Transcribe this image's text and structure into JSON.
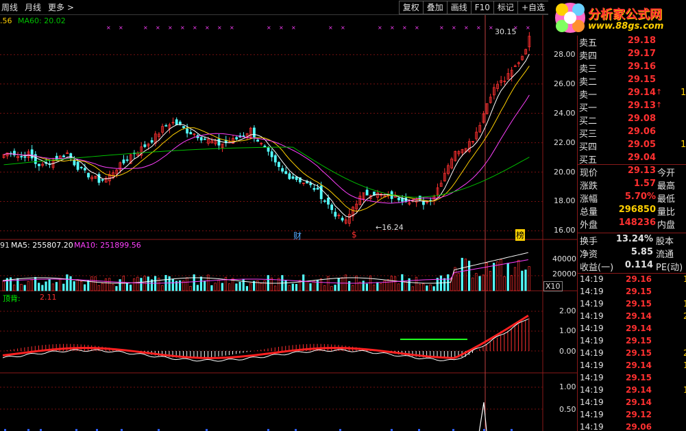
{
  "toolbar": {
    "left": [
      "周线",
      "月线",
      "更多 >"
    ],
    "right": [
      "复权",
      "叠加",
      "画线",
      "F10",
      "标记",
      "+自选"
    ]
  },
  "logo": {
    "title": "分析家公式网",
    "url": "www.88gs.com"
  },
  "main_legend": {
    "ma60": "MA60: 20.02",
    "prefix": ".56"
  },
  "price_axis": [
    "28.00",
    "26.00",
    "24.00",
    "22.00",
    "20.00",
    "18.00",
    "16.00"
  ],
  "annotations": {
    "high": "30.15",
    "low": "16.24",
    "cai": "财",
    "dollar": "$",
    "bang": "榜"
  },
  "vol_legend": {
    "prefix": "91",
    "ma5": "MA5: 255807.20",
    "ma10": "MA10: 251899.56"
  },
  "vol_axis": [
    "40000",
    "20000"
  ],
  "vol_unit": "X10",
  "ind_legend": {
    "name": "顶背:",
    "value": "2.11"
  },
  "ind_axis": [
    "2.00",
    "1.00",
    "0.00"
  ],
  "ind2_axis": [
    "1.00",
    "0.50"
  ],
  "order_book": [
    {
      "label": "卖五",
      "price": "29.18",
      "arrow": "",
      "extra": ""
    },
    {
      "label": "卖四",
      "price": "29.17",
      "arrow": "",
      "extra": ""
    },
    {
      "label": "卖三",
      "price": "29.16",
      "arrow": "",
      "extra": ""
    },
    {
      "label": "卖二",
      "price": "29.15",
      "arrow": "",
      "extra": ""
    },
    {
      "label": "卖一",
      "price": "29.14",
      "arrow": "↑",
      "extra": "1"
    },
    {
      "label": "买一",
      "price": "29.13",
      "arrow": "↑",
      "extra": ""
    },
    {
      "label": "买二",
      "price": "29.08",
      "arrow": "",
      "extra": ""
    },
    {
      "label": "买三",
      "price": "29.06",
      "arrow": "",
      "extra": ""
    },
    {
      "label": "买四",
      "price": "29.05",
      "arrow": "",
      "extra": "1"
    },
    {
      "label": "买五",
      "price": "29.04",
      "arrow": "",
      "extra": ""
    }
  ],
  "stats": [
    {
      "label": "现价",
      "value": "29.13",
      "label2": "今开",
      "color": "#ff3030"
    },
    {
      "label": "涨跌",
      "value": "1.57",
      "label2": "最高",
      "color": "#ff3030"
    },
    {
      "label": "涨幅",
      "value": "5.70%",
      "label2": "最低",
      "color": "#ff3030"
    },
    {
      "label": "总量",
      "value": "296850",
      "label2": "量比",
      "color": "#ffd000"
    },
    {
      "label": "外盘",
      "value": "148236",
      "label2": "内盘",
      "color": "#ff3030"
    }
  ],
  "stats2": [
    {
      "label": "换手",
      "value": "13.24%",
      "label2": "股本",
      "color": "#e0e0e0"
    },
    {
      "label": "净资",
      "value": "5.85",
      "label2": "流通",
      "color": "#e0e0e0"
    },
    {
      "label": "收益(一)",
      "value": "0.114",
      "label2": "PE(动)",
      "color": "#e0e0e0"
    }
  ],
  "ticks": [
    {
      "time": "14:19",
      "price": "29.16",
      "extra": "1"
    },
    {
      "time": "14:19",
      "price": "29.15",
      "extra": ""
    },
    {
      "time": "14:19",
      "price": "29.15",
      "extra": "1"
    },
    {
      "time": "14:19",
      "price": "29.14",
      "extra": "2"
    },
    {
      "time": "14:19",
      "price": "29.14",
      "extra": ""
    },
    {
      "time": "14:19",
      "price": "29.15",
      "extra": ""
    },
    {
      "time": "14:19",
      "price": "29.15",
      "extra": "2"
    },
    {
      "time": "14:19",
      "price": "29.14",
      "extra": "1"
    },
    {
      "time": "14:19",
      "price": "29.15",
      "extra": ""
    },
    {
      "time": "14:19",
      "price": "29.14",
      "extra": "1"
    },
    {
      "time": "14:19",
      "price": "29.14",
      "extra": ""
    },
    {
      "time": "14:19",
      "price": "29.12",
      "extra": ""
    },
    {
      "time": "14:19",
      "price": "29.06",
      "extra": ""
    }
  ],
  "colors": {
    "up": "#ff3030",
    "down": "#54ffff",
    "ma5": "#ffffff",
    "ma10": "#ffd000",
    "ma20": "#ff40ff",
    "ma60": "#00c000",
    "grid": "#7a1010"
  },
  "chart_data": {
    "type": "candlestick",
    "note_series": "daily price trend, approximate",
    "prices": [
      21.2,
      21.4,
      21.0,
      21.3,
      20.6,
      20.4,
      20.8,
      21.0,
      21.3,
      20.5,
      20.0,
      19.7,
      19.4,
      19.6,
      20.2,
      20.6,
      21.2,
      21.5,
      21.9,
      22.4,
      23.0,
      23.4,
      23.2,
      22.8,
      22.6,
      22.3,
      22.1,
      21.9,
      22.0,
      22.2,
      22.5,
      22.9,
      22.1,
      21.4,
      20.6,
      20.0,
      19.7,
      19.5,
      19.2,
      18.9,
      18.3,
      17.6,
      16.9,
      16.6,
      17.8,
      18.4,
      18.6,
      18.5,
      18.3,
      18.3,
      18.2,
      18.1,
      18.0,
      17.9,
      18.4,
      19.5,
      20.8,
      21.5,
      21.8,
      22.3,
      23.6,
      25.2,
      26.0,
      26.3,
      27.0,
      27.8,
      29.1
    ],
    "ma60_start": 20.5,
    "ma60_mid": 21.7,
    "ma60_end": 20.0,
    "high": 30.15,
    "low": 16.24,
    "ylim": [
      15.6,
      30.6
    ]
  }
}
